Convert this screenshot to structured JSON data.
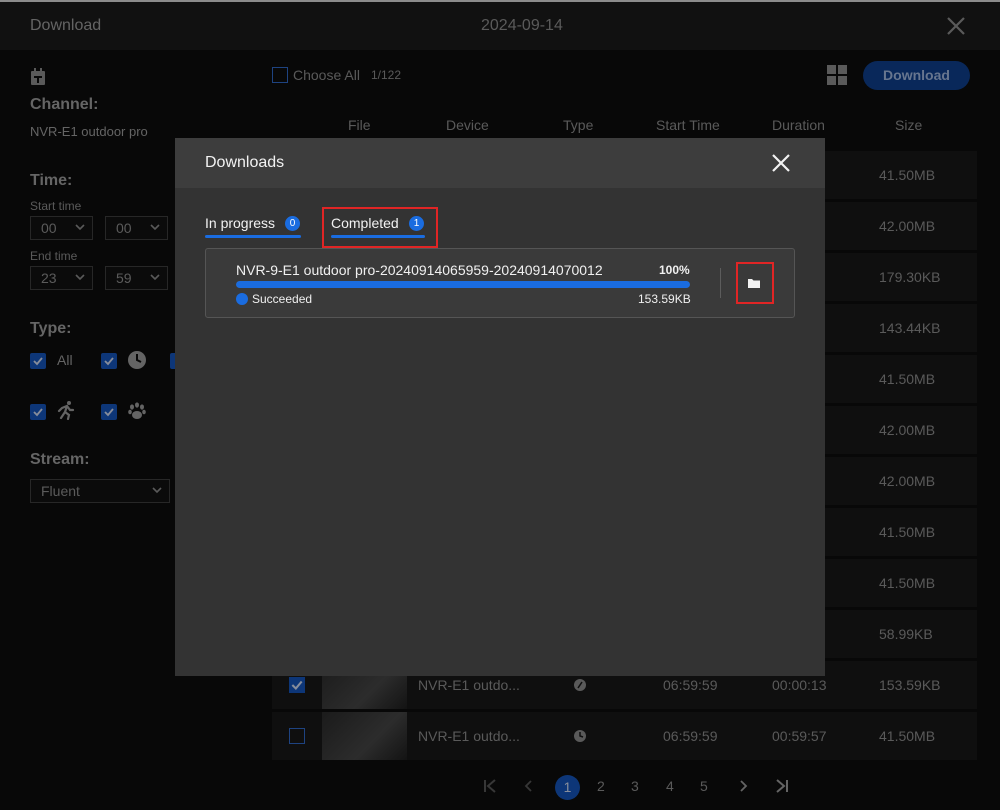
{
  "window": {
    "title": "Download",
    "date": "2024-09-14"
  },
  "filters": {
    "channel_label": "Channel:",
    "channel_value": "NVR-E1 outdoor pro",
    "time_label": "Time:",
    "start_time_label": "Start time",
    "start_hour": "00",
    "start_minute": "00",
    "end_time_label": "End time",
    "end_hour": "23",
    "end_minute": "59",
    "type_label": "Type:",
    "type_all": "All",
    "stream_label": "Stream:",
    "stream_value": "Fluent"
  },
  "toolbar": {
    "choose_all": "Choose All",
    "count": "1/122",
    "download_button": "Download"
  },
  "columns": [
    "File",
    "Device",
    "Type",
    "Start Time",
    "Duration",
    "Size"
  ],
  "rows": [
    {
      "size": "41.50MB"
    },
    {
      "size": "42.00MB"
    },
    {
      "size": "179.30KB"
    },
    {
      "size": "143.44KB"
    },
    {
      "size": "41.50MB"
    },
    {
      "size": "42.00MB"
    },
    {
      "size": "42.00MB"
    },
    {
      "size": "41.50MB"
    },
    {
      "size": "41.50MB"
    },
    {
      "size": "58.99KB"
    },
    {
      "file": "NVR-E1 outdo...",
      "start": "06:59:59",
      "duration": "00:00:13",
      "size": "153.59KB",
      "checked": true
    },
    {
      "file": "NVR-E1 outdo...",
      "start": "06:59:59",
      "duration": "00:59:57",
      "size": "41.50MB",
      "checked": false
    }
  ],
  "pagination": {
    "current": "1",
    "pages": [
      "2",
      "3",
      "4",
      "5"
    ]
  },
  "modal": {
    "title": "Downloads",
    "tab_in_progress": "In progress",
    "tab_in_progress_count": "0",
    "tab_completed": "Completed",
    "tab_completed_count": "1",
    "item": {
      "filename": "NVR-9-E1 outdoor pro-20240914065959-20240914070012",
      "percent": "100%",
      "progress": 1.0,
      "status": "Succeeded",
      "size": "153.59KB"
    }
  },
  "colors": {
    "accent": "#1a6ce0",
    "highlight": "#e02525"
  }
}
